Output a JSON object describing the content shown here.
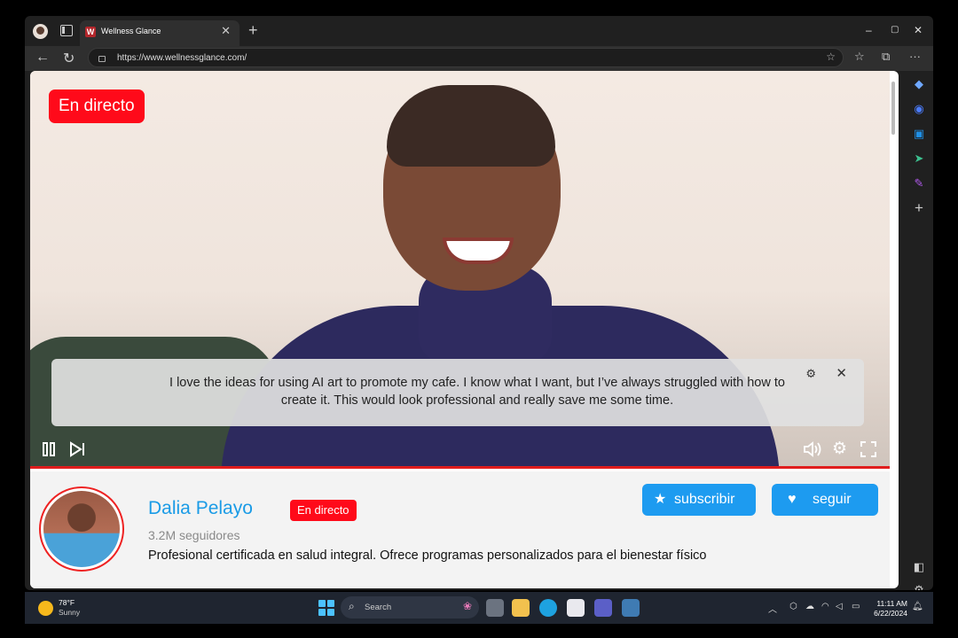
{
  "browser": {
    "tab_title": "Wellness Glance",
    "tab_favicon": "W",
    "url": "https://www.wellnessglance.com/",
    "controls": {
      "minimize": "–",
      "maximize": "▢",
      "close": "✕"
    }
  },
  "video": {
    "live_badge": "En directo",
    "caption": "I love the ideas for using AI art to promote my cafe. I know what I want, but I’ve always struggled with how to create it. This would look professional and really save me some time.",
    "progress": 1.0
  },
  "channel": {
    "name": "Dalia Pelayo",
    "live_badge": "En directo",
    "followers": "3.2M seguidores",
    "description": "Profesional certificada en salud integral. Ofrece programas personalizados para el bienestar físico",
    "subscribe_label": "subscribir",
    "follow_label": "seguir"
  },
  "colors": {
    "live_red": "#ff0a1a",
    "accent_blue": "#1d9bf0",
    "name_blue": "#1a9be6"
  },
  "taskbar": {
    "weather_temp": "78°F",
    "weather_condition": "Sunny",
    "search_placeholder": "Search",
    "time": "11:11 AM",
    "date": "6/22/2024"
  }
}
